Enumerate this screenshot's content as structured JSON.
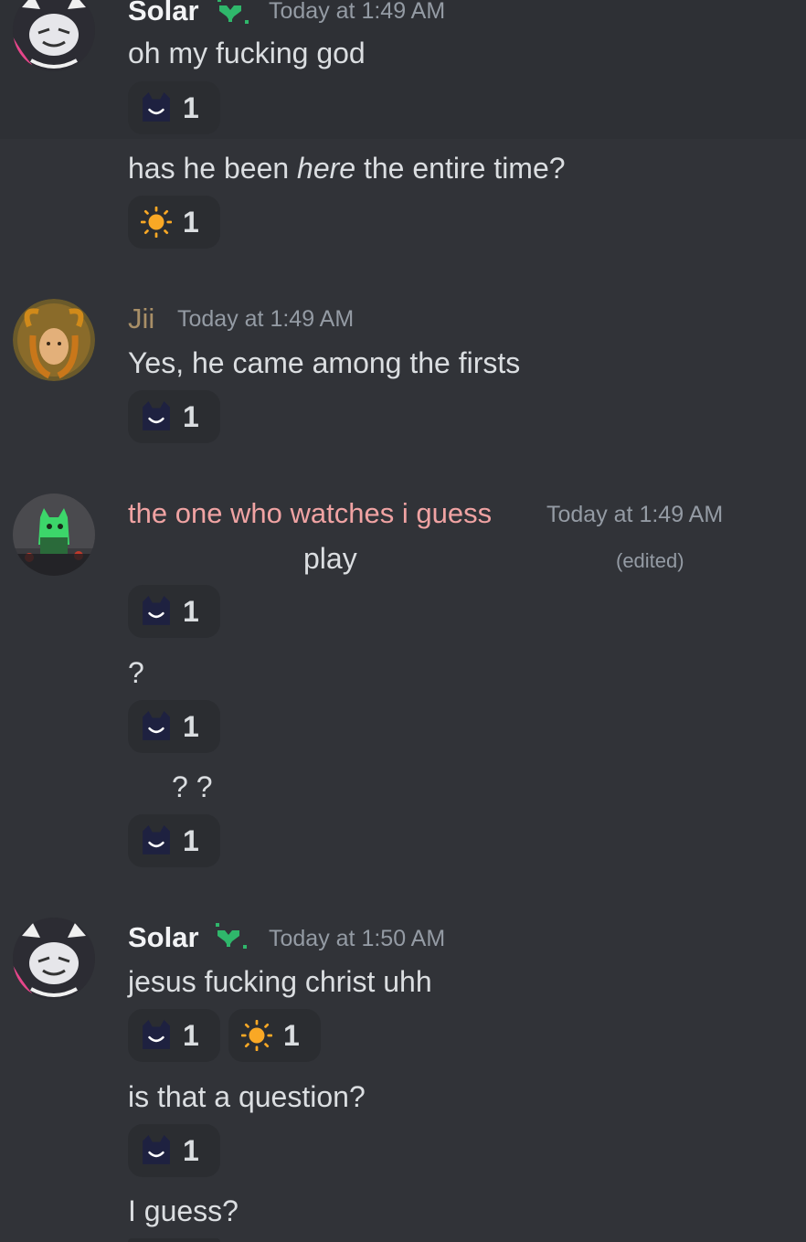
{
  "colors": {
    "background": "#313338",
    "reaction_bg": "#2b2d31",
    "timestamp": "#949ba4",
    "name_solar": "#f2f3f5",
    "name_jii": "#a88f67",
    "name_watcher": "#f0a3a3",
    "badge_green": "#2fb76b",
    "sun": "#f9a825"
  },
  "messages": [
    {
      "author": "Solar",
      "timestamp": "Today at 1:49 AM",
      "badge_icon": "sprout-icon",
      "lines": [
        {
          "text": "oh my fucking god",
          "reactions": [
            {
              "emoji": "cat-smile-icon",
              "count": "1"
            }
          ]
        },
        {
          "text_before": "has he been ",
          "text_italic": "here",
          "text_after": " the entire time?",
          "reactions": [
            {
              "emoji": "sun-icon",
              "count": "1"
            }
          ]
        }
      ]
    },
    {
      "author": "Jii",
      "timestamp": "Today at 1:49 AM",
      "lines": [
        {
          "text": "Yes, he came among the firsts",
          "reactions": [
            {
              "emoji": "cat-smile-icon",
              "count": "1"
            }
          ]
        }
      ]
    },
    {
      "author": "the one who watches i guess",
      "timestamp": "Today at 1:49 AM",
      "lines": [
        {
          "text": "play",
          "edited": "(edited)",
          "reactions": [
            {
              "emoji": "cat-smile-icon",
              "count": "1"
            }
          ]
        },
        {
          "text": "?",
          "reactions": [
            {
              "emoji": "cat-smile-icon",
              "count": "1"
            }
          ]
        },
        {
          "text": "? ?",
          "reactions": [
            {
              "emoji": "cat-smile-icon",
              "count": "1"
            }
          ]
        }
      ]
    },
    {
      "author": "Solar",
      "timestamp": "Today at 1:50 AM",
      "badge_icon": "sprout-icon",
      "lines": [
        {
          "text": "jesus fucking christ uhh",
          "reactions": [
            {
              "emoji": "cat-smile-icon",
              "count": "1"
            },
            {
              "emoji": "sun-icon",
              "count": "1"
            }
          ]
        },
        {
          "text": "is that a question?",
          "reactions": [
            {
              "emoji": "cat-smile-icon",
              "count": "1"
            }
          ]
        },
        {
          "text": "I guess?"
        }
      ]
    }
  ]
}
